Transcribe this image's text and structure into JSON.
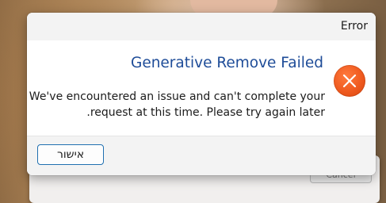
{
  "background_dialog": {
    "cancel_label": "Cancel"
  },
  "dialog": {
    "title": "Error",
    "headline": "Generative Remove Failed",
    "message_line1": "We've encountered an issue and can't complete your",
    "message_line2": ".request at this time. Please try again later",
    "icon": "error-x-icon",
    "ok_label": "אישור"
  },
  "colors": {
    "headline": "#1e4c98",
    "icon_fill": "#ef5a1f",
    "button_border": "#1f6fb0",
    "titlebar_bg": "#f3f3f3"
  }
}
